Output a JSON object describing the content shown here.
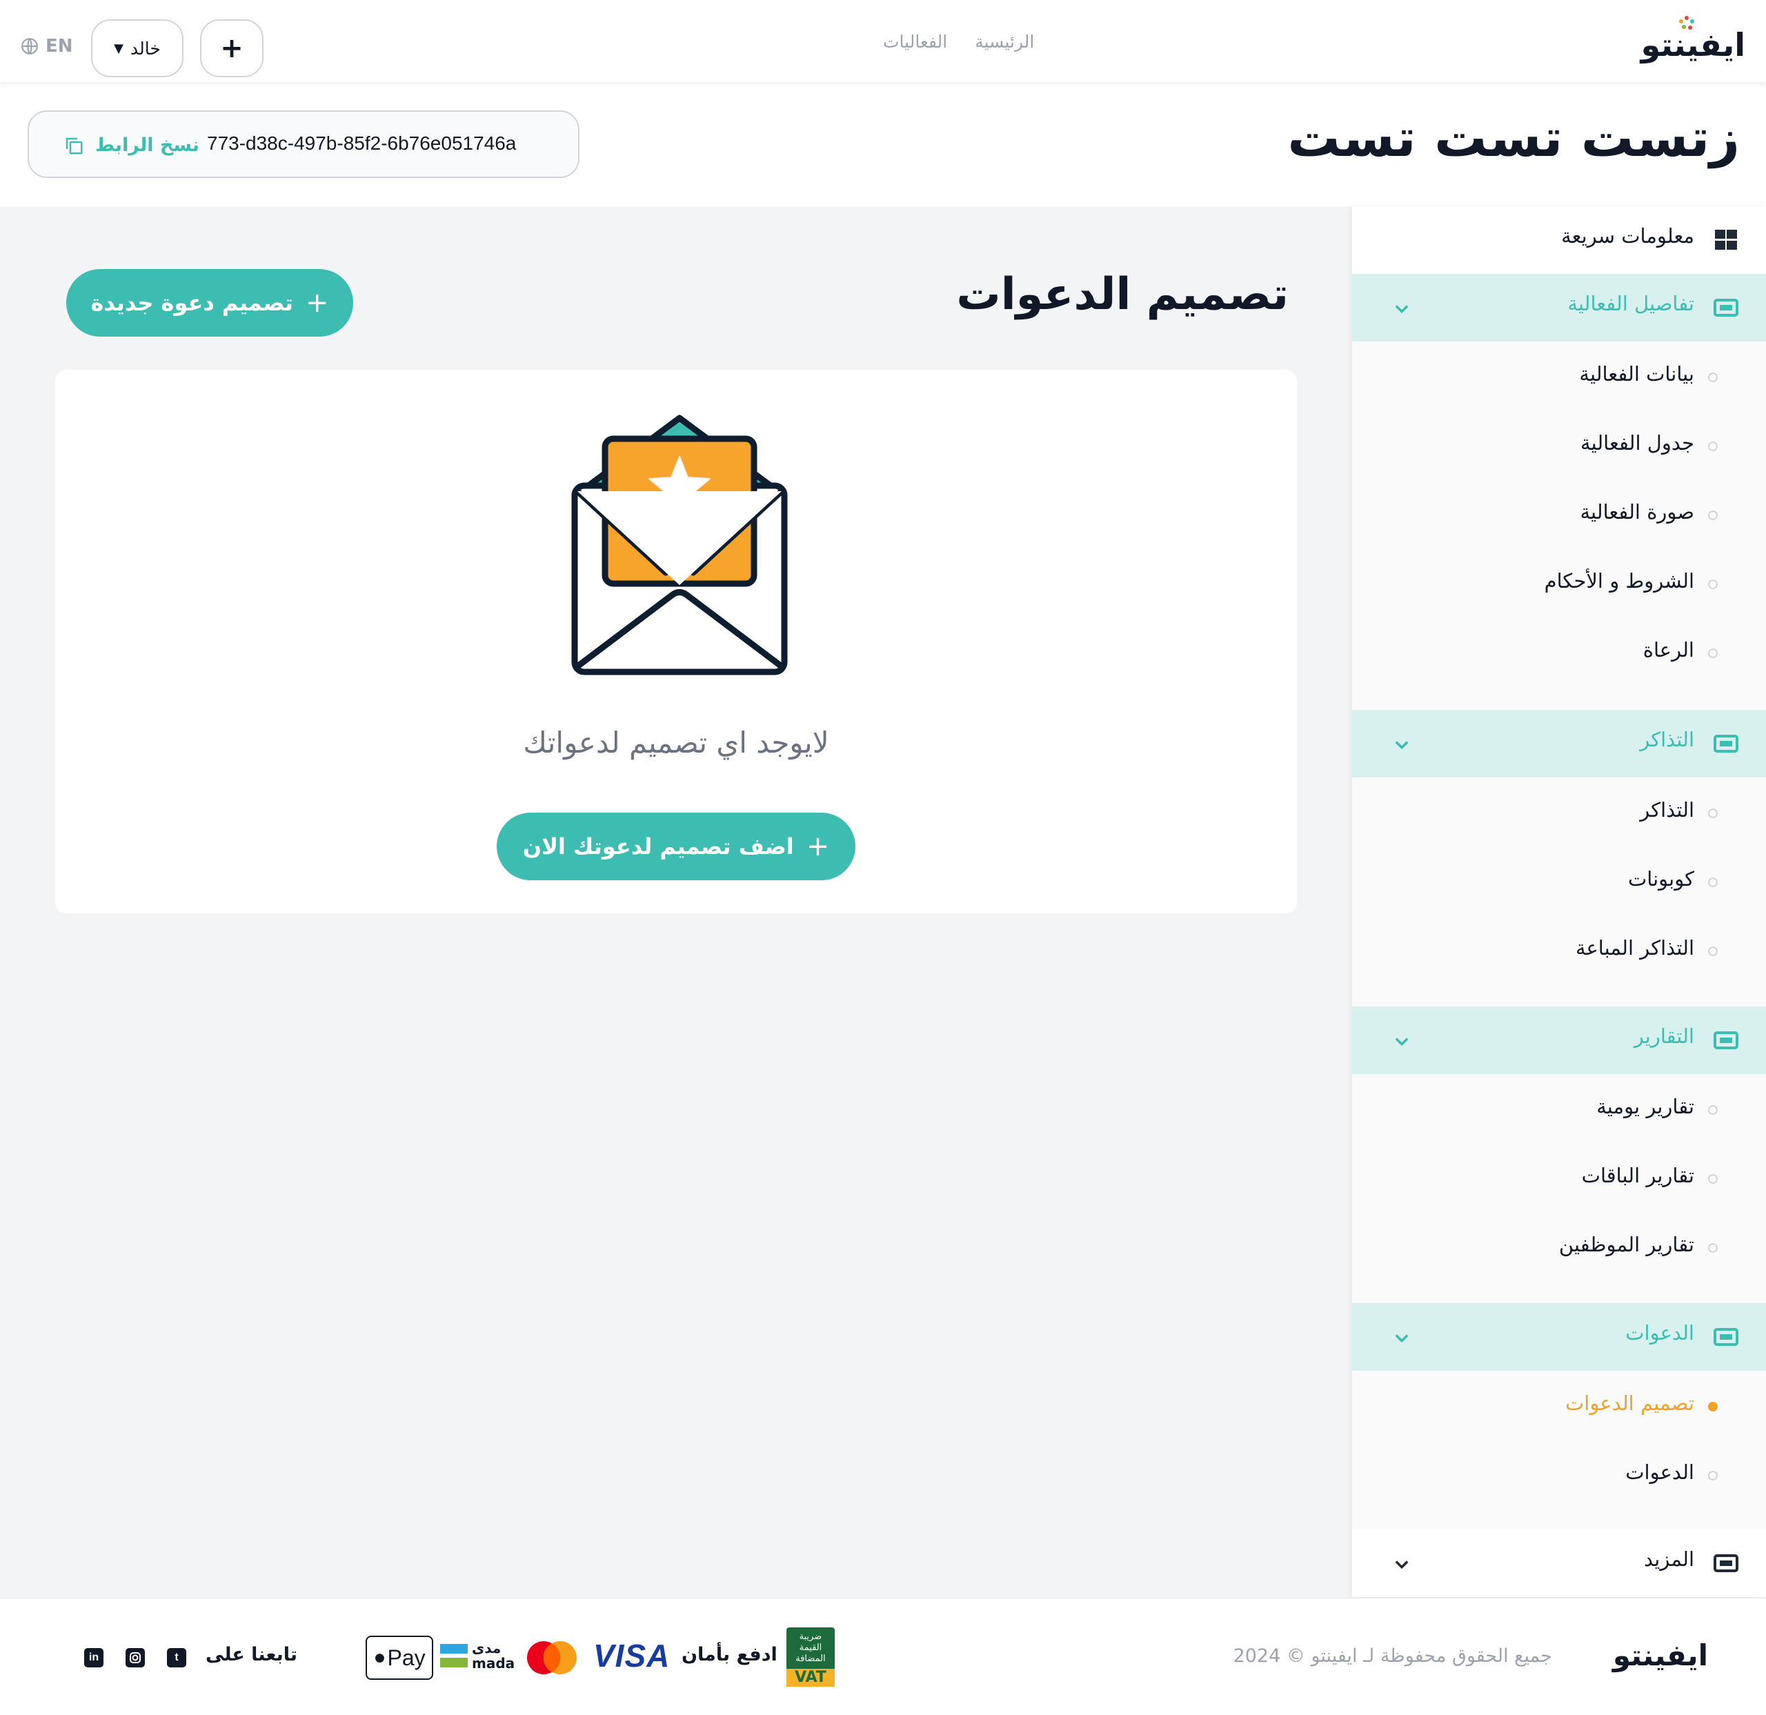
{
  "topbar": {
    "logo": "ايفينتو",
    "nav": [
      "الرئيسية",
      "الفعاليات"
    ],
    "lang": "EN",
    "user_label": "خالد",
    "plus_label": "+"
  },
  "header": {
    "event_title": "زتست تست تست",
    "event_link": "773-d38c-497b-85f2-6b76e051746a",
    "copy_label": "نسخ الرابط"
  },
  "sidebar": {
    "quick_info": "معلومات سريعة",
    "sections": [
      {
        "label": "تفاصيل الفعالية",
        "items": [
          "بيانات الفعالية",
          "جدول الفعالية",
          "صورة الفعالية",
          "الشروط و الأحكام",
          "الرعاة"
        ]
      },
      {
        "label": "التذاكر",
        "items": [
          "التذاكر",
          "كوبونات",
          "التذاكر المباعة"
        ]
      },
      {
        "label": "التقارير",
        "items": [
          "تقارير يومية",
          "تقارير الباقات",
          "تقارير الموظفين"
        ]
      },
      {
        "label": "الدعوات",
        "items": [
          "تصميم الدعوات",
          "الدعوات"
        ]
      }
    ],
    "active_item": "تصميم الدعوات",
    "more": "المزيد"
  },
  "main": {
    "heading": "تصميم الدعوات",
    "new_button": "تصميم دعوة جديدة",
    "empty_text": "لايوجد اي تصميم لدعواتك",
    "add_button": "اضف تصميم لدعوتك الان"
  },
  "footer": {
    "logo": "ايفينتو",
    "copyright": "جميع الحقوق محفوظة لـ ايفينتو © 2024",
    "vat_text": [
      "ضريبة",
      "القيمة",
      "المضافة"
    ],
    "vat_badge": "VAT",
    "pay_safe": "ادفع بأمان",
    "visa": "VISA",
    "mada_ar": "مدى",
    "mada_en": "mada",
    "apple_pay": "Pay",
    "follow": "تابعنا على"
  },
  "colors": {
    "accent": "#3dbdb1",
    "accent_light": "#d8f1ee",
    "active": "#f0a12a",
    "text": "#111827",
    "muted": "#9ca3af"
  }
}
